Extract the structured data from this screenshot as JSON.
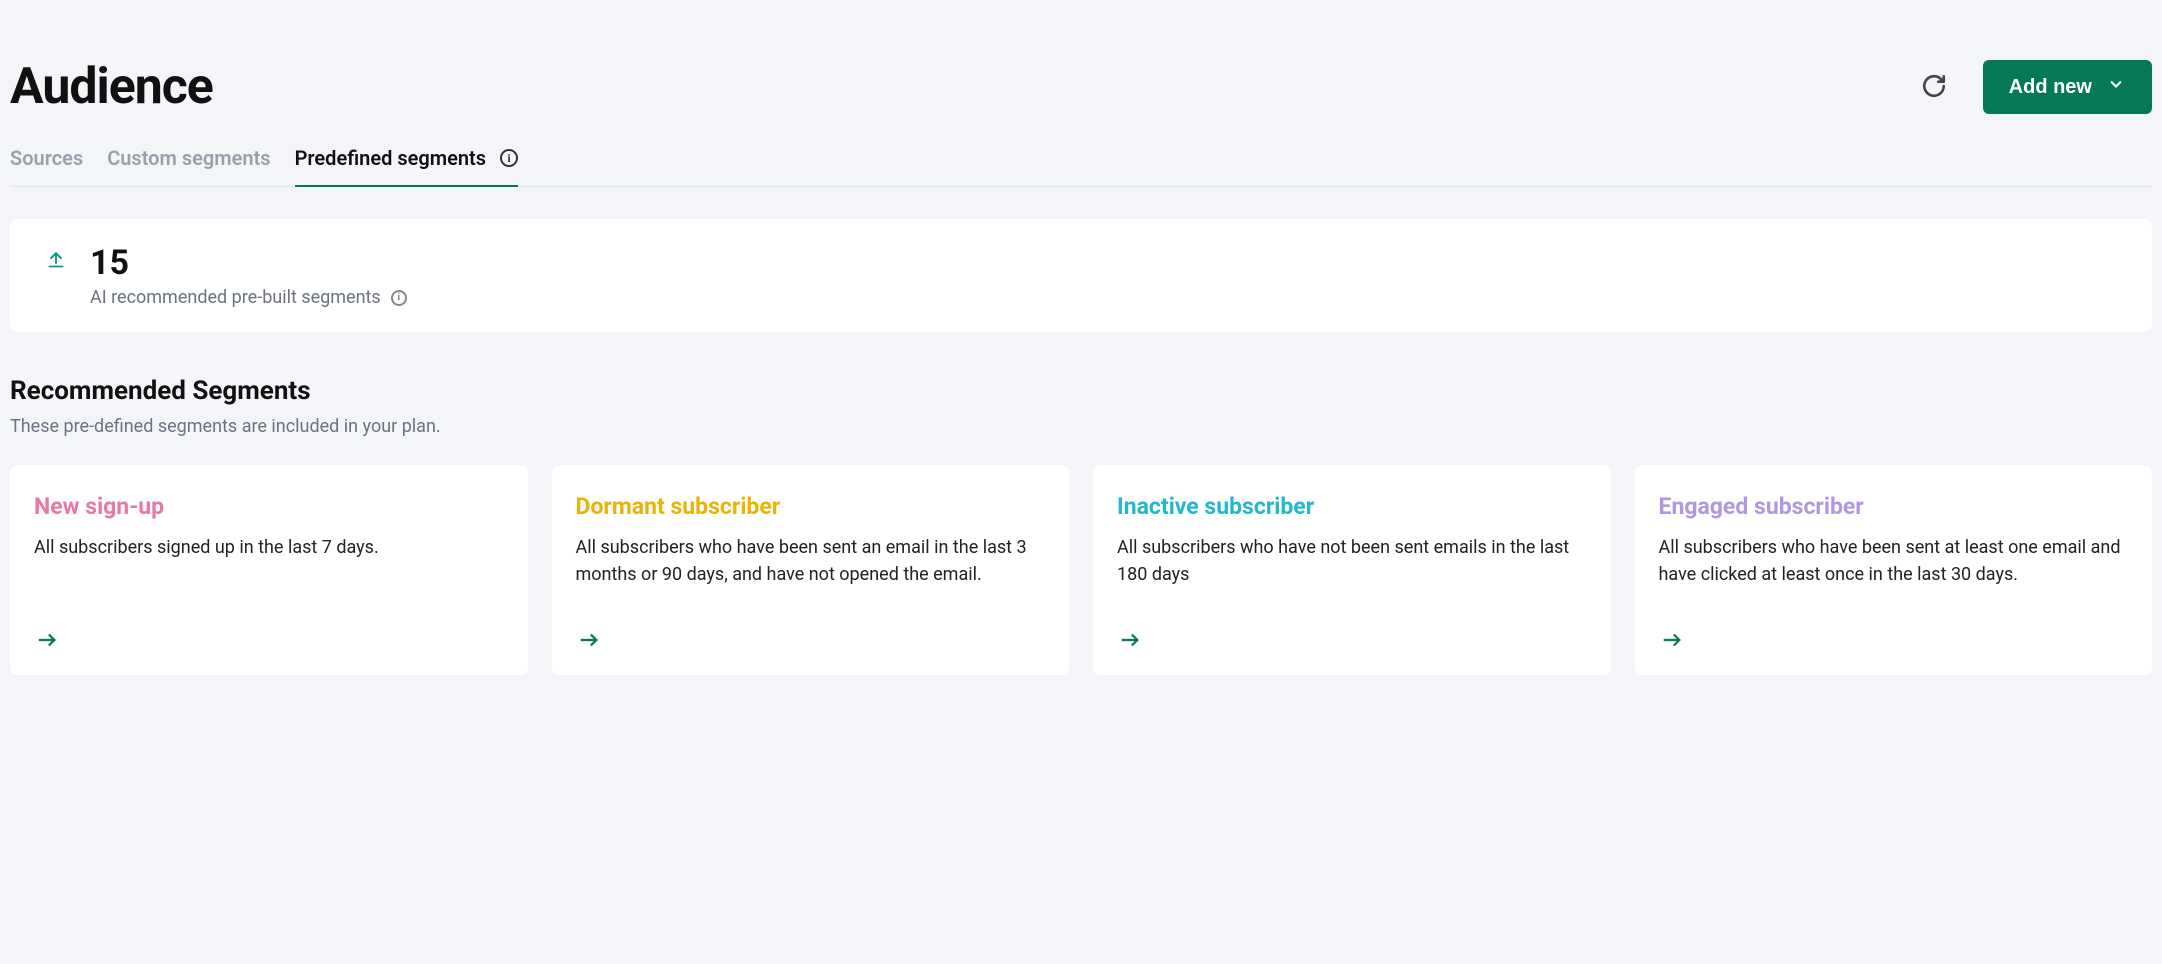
{
  "header": {
    "title": "Audience",
    "add_button": "Add new"
  },
  "tabs": [
    {
      "label": "Sources"
    },
    {
      "label": "Custom segments"
    },
    {
      "label": "Predefined segments",
      "active": true
    }
  ],
  "stats": {
    "value": "15",
    "label": "AI recommended pre-built segments"
  },
  "recommended": {
    "title": "Recommended Segments",
    "subtitle": "These pre-defined segments are included in your plan.",
    "cards": [
      {
        "title": "New sign-up",
        "desc": "All subscribers signed up in the last 7 days.",
        "color": "pink"
      },
      {
        "title": "Dormant subscriber",
        "desc": "All subscribers who have been sent an email in the last 3 months or 90 days, and have not opened the email.",
        "color": "gold"
      },
      {
        "title": "Inactive subscriber",
        "desc": "All subscribers who have not been sent emails in the last 180 days",
        "color": "cyan"
      },
      {
        "title": "Engaged subscriber",
        "desc": "All subscribers who have been sent at least one email and have clicked at least once in the last 30 days.",
        "color": "purple"
      }
    ]
  }
}
